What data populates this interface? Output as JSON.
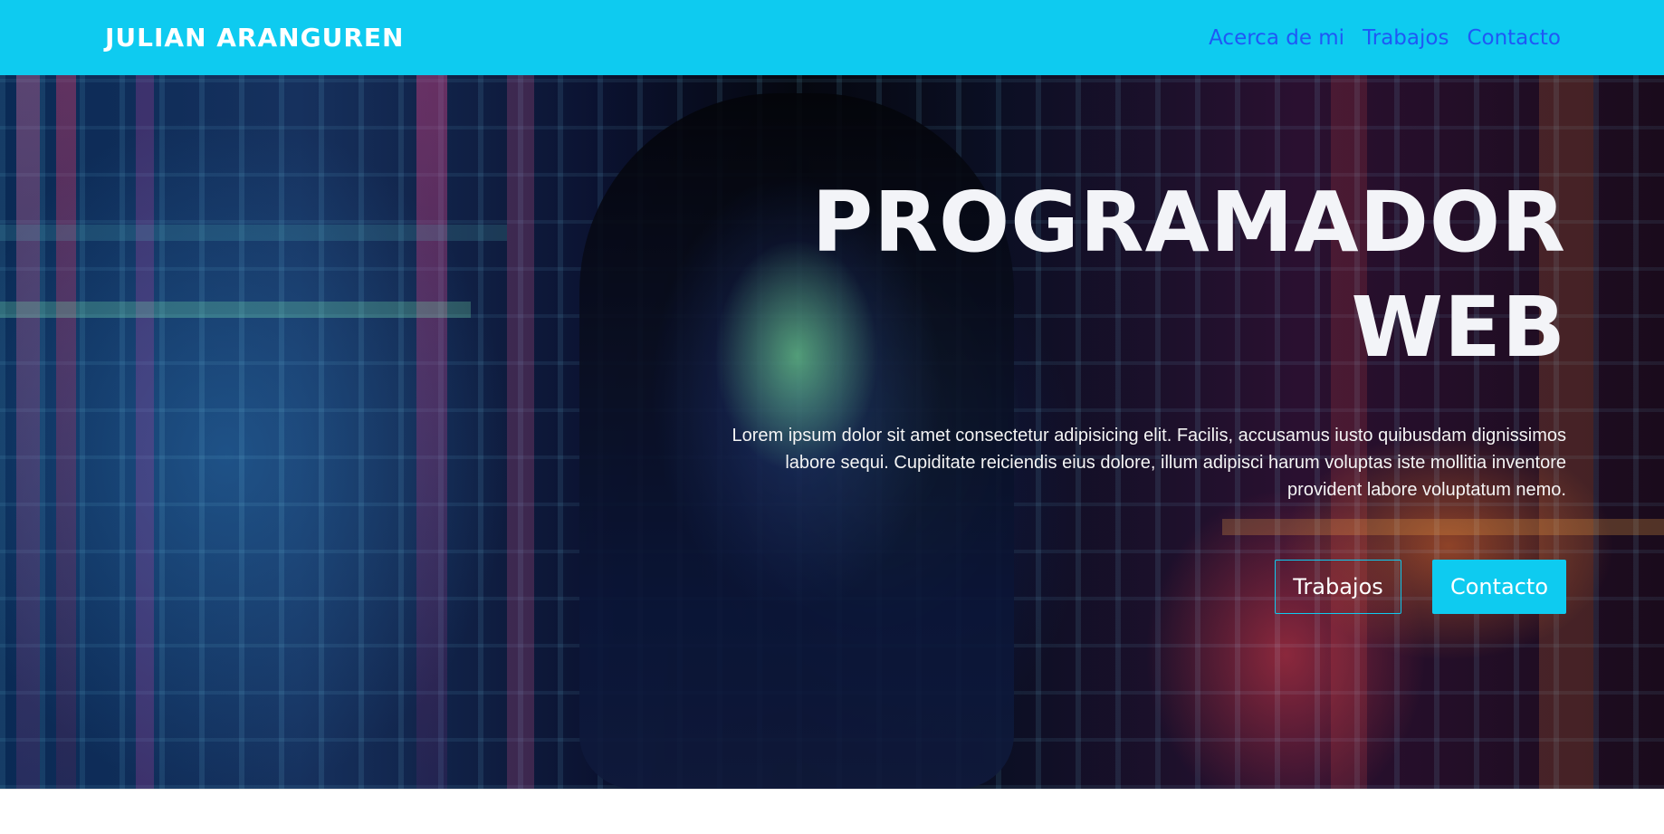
{
  "header": {
    "brand": "JULIAN ARANGUREN",
    "nav": [
      {
        "label": "Acerca de mi"
      },
      {
        "label": "Trabajos"
      },
      {
        "label": "Contacto"
      }
    ]
  },
  "hero": {
    "title_line1": "PROGRAMADOR",
    "title_line2": "WEB",
    "description": "Lorem ipsum dolor sit amet consectetur adipisicing elit. Facilis, accusamus iusto quibusdam dignissimos labore sequi. Cupiditate reiciendis eius dolore, illum adipisci harum voluptas iste mollitia inventore provident labore voluptatum nemo.",
    "buttons": {
      "secondary": "Trabajos",
      "primary": "Contacto"
    }
  },
  "colors": {
    "accent": "#0ecbf0",
    "nav_link": "#1f58f5",
    "hero_text": "#f3f4f8"
  }
}
